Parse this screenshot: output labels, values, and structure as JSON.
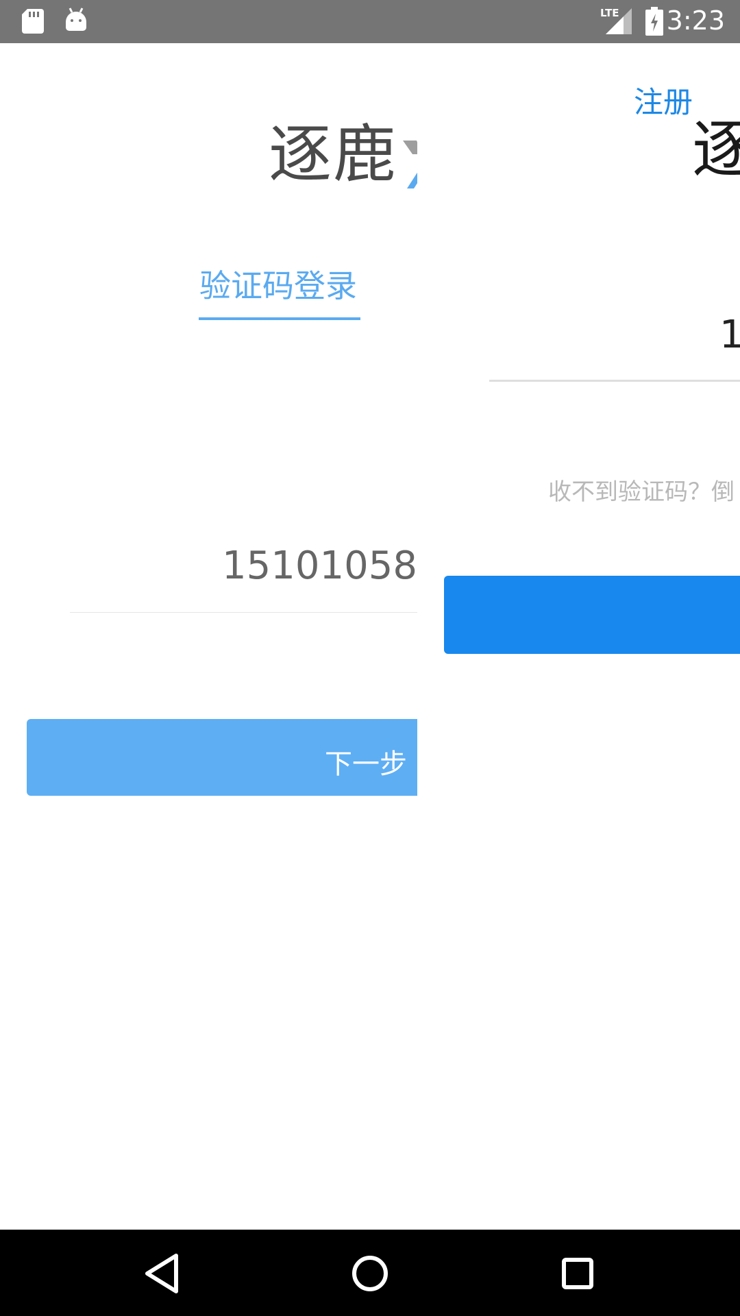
{
  "status_bar": {
    "time": "3:23",
    "network": "LTE",
    "icons": [
      "sd-card-icon",
      "android-debug-icon",
      "lte-signal-icon",
      "battery-charging-icon"
    ]
  },
  "left_panel": {
    "logo_text": "逐鹿",
    "tab_label": "验证码登录",
    "phone_value": "15101058",
    "next_label": "下一步",
    "accent_color": "#5aaaf0"
  },
  "right_panel": {
    "register_label": "注册",
    "logo_text": "逐",
    "phone_value": "1",
    "resend_hint": "收不到验证码？倒",
    "button_color": "#1888ee"
  },
  "nav_bar": {
    "icons": [
      "back-icon",
      "home-icon",
      "recents-icon"
    ]
  }
}
